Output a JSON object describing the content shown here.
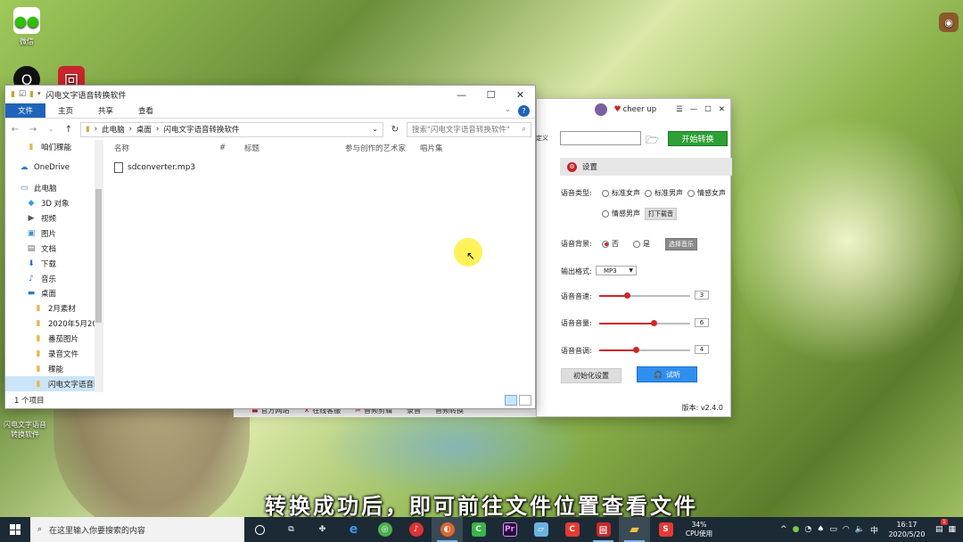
{
  "desktop": {
    "icons": [
      {
        "label": "微信",
        "name": "wechat"
      },
      {
        "label": "",
        "name": "qq"
      },
      {
        "label": "",
        "name": "app-red"
      },
      {
        "label": "闪电文字语音\n转换软件",
        "name": "converter-shortcut"
      }
    ]
  },
  "explorer": {
    "title": "闪电文字语音转换软件",
    "ribbon_tabs": [
      "文件",
      "主页",
      "共享",
      "查看"
    ],
    "breadcrumb": [
      "此电脑",
      "桌面",
      "闪电文字语音转换软件"
    ],
    "search_placeholder": "搜索\"闪电文字语音转换软件\"",
    "nav": [
      {
        "label": "咱们稞能",
        "icon": "folder",
        "indent": 1
      },
      {
        "label": "OneDrive",
        "icon": "cloud",
        "indent": 0
      },
      {
        "label": "此电脑",
        "icon": "pc",
        "indent": 0
      },
      {
        "label": "3D 对象",
        "icon": "cube",
        "indent": 1
      },
      {
        "label": "视频",
        "icon": "video",
        "indent": 1
      },
      {
        "label": "图片",
        "icon": "picture",
        "indent": 1
      },
      {
        "label": "文档",
        "icon": "document",
        "indent": 1
      },
      {
        "label": "下载",
        "icon": "download",
        "indent": 1
      },
      {
        "label": "音乐",
        "icon": "music",
        "indent": 1
      },
      {
        "label": "桌面",
        "icon": "desktop",
        "indent": 1
      },
      {
        "label": "2月素材",
        "icon": "folder",
        "indent": 2
      },
      {
        "label": "2020年5月20",
        "icon": "folder",
        "indent": 2
      },
      {
        "label": "番茄图片",
        "icon": "folder",
        "indent": 2
      },
      {
        "label": "录音文件",
        "icon": "folder",
        "indent": 2
      },
      {
        "label": "稞能",
        "icon": "folder",
        "indent": 2
      },
      {
        "label": "闪电文字语音转",
        "icon": "folder",
        "indent": 2,
        "selected": true
      }
    ],
    "columns": [
      "名称",
      "#",
      "标题",
      "参与创作的艺术家",
      "唱片集"
    ],
    "files": [
      {
        "name": "sdconverter.mp3"
      }
    ],
    "status": "1 个项目"
  },
  "app": {
    "user": "cheer up",
    "left_label": "自定义",
    "start_label": "开始转换",
    "settings_title": "设置",
    "voice_type_label": "语音类型:",
    "voice_types": [
      "标准女声",
      "标准男声",
      "情感女声",
      "情感男声"
    ],
    "more_voices": "打下载音",
    "bg_label": "语音背景:",
    "bg_no": "否",
    "bg_yes": "是",
    "bg_music_btn": "选择音乐",
    "format_label": "输出格式:",
    "format_value": "MP3",
    "speed_label": "语音音速:",
    "speed_value": "3",
    "speed": 0.3,
    "volume_label": "语音音量:",
    "volume_value": "6",
    "volume": 0.6,
    "pitch_label": "语音音调:",
    "pitch_value": "4",
    "pitch": 0.4,
    "init_label": "初始化设置",
    "try_label": "试听",
    "version": "版本: v2.4.0",
    "bottom_links": [
      "官方网站",
      "在线客服",
      "音频剪辑",
      "录音",
      "音频转换"
    ]
  },
  "subtitle": "转换成功后，即可前往文件位置查看文件",
  "taskbar": {
    "search_placeholder": "在这里输入你要搜索的内容",
    "cpu_percent": "34%",
    "cpu_label": "CPU使用",
    "time": "16:17",
    "date": "2020/5/20",
    "notify_count": "1",
    "colors": {
      "accent": "#1f64b8",
      "start_green": "#2ea036",
      "try_blue": "#2f8ff0",
      "brand_red": "#c0252b"
    }
  }
}
